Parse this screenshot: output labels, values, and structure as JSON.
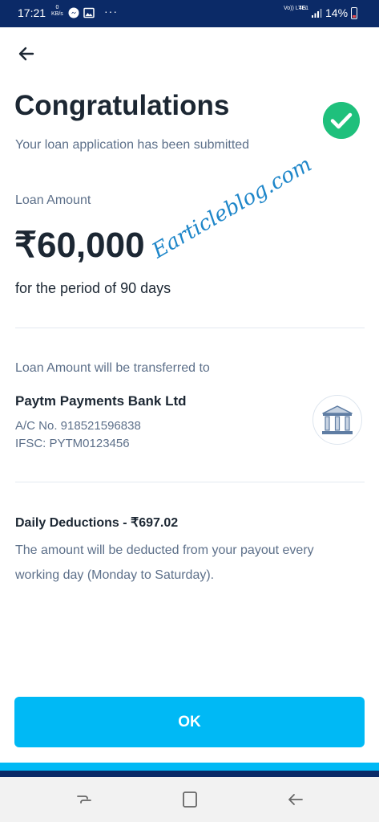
{
  "status_bar": {
    "time": "17:21",
    "kbs_value": "0",
    "kbs_unit": "KB/s",
    "network_left": "Vo)) LTE1",
    "network_right": "4G",
    "battery": "14%"
  },
  "header": {
    "title": "Congratulations",
    "subtitle": "Your loan application has been submitted"
  },
  "loan": {
    "label": "Loan Amount",
    "amount": "₹60,000",
    "period": "for the period of 90 days"
  },
  "watermark": "Earticleblog.com",
  "transfer": {
    "label": "Loan Amount will be transferred to",
    "bank_name": "Paytm Payments Bank Ltd",
    "account": "A/C No. 918521596838",
    "ifsc": "IFSC: PYTM0123456"
  },
  "deductions": {
    "title": "Daily Deductions - ₹697.02",
    "description": "The amount will be deducted from your payout every working day (Monday to Saturday)."
  },
  "actions": {
    "ok_label": "OK"
  },
  "colors": {
    "primary_dark": "#0b2a67",
    "accent": "#00b9f5",
    "success": "#1fc07c"
  }
}
